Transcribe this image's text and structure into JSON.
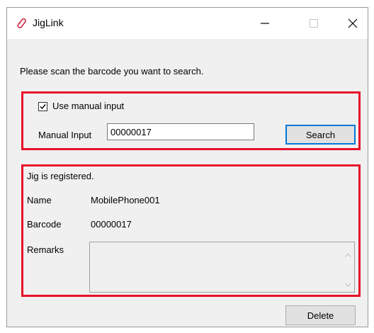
{
  "window": {
    "title": "JigLink"
  },
  "main": {
    "instruction": "Please scan the barcode you want to search."
  },
  "manual_section": {
    "checkbox_label": "Use manual input",
    "checkbox_checked": true,
    "input_label": "Manual Input",
    "input_value": "00000017",
    "search_label": "Search"
  },
  "result_section": {
    "status": "Jig is registered.",
    "name_label": "Name",
    "name_value": "MobilePhone001",
    "barcode_label": "Barcode",
    "barcode_value": "00000017",
    "remarks_label": "Remarks",
    "remarks_value": ""
  },
  "footer": {
    "delete_label": "Delete"
  },
  "colors": {
    "highlight_border": "#e8102a",
    "default_button_border": "#0078d7",
    "window_bg": "#f0f0f0"
  }
}
